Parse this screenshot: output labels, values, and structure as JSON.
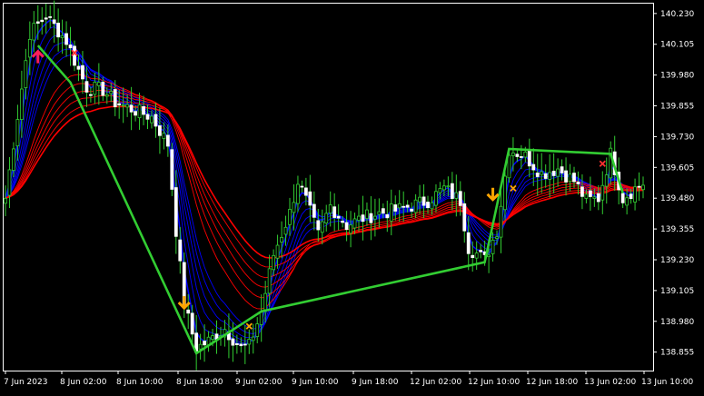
{
  "chart_data": {
    "type": "candlestick",
    "instrument_timeframe": "",
    "y_ticks": [
      "140.230",
      "140.105",
      "139.980",
      "139.855",
      "139.730",
      "139.605",
      "139.480",
      "139.355",
      "139.230",
      "139.105",
      "138.980",
      "138.855"
    ],
    "y_range": [
      138.78,
      140.27
    ],
    "x_ticks": [
      "7 Jun 2023",
      "8 Jun 02:00",
      "8 Jun 10:00",
      "8 Jun 18:00",
      "9 Jun 02:00",
      "9 Jun 10:00",
      "9 Jun 18:00",
      "12 Jun 02:00",
      "12 Jun 10:00",
      "12 Jun 18:00",
      "13 Jun 02:00",
      "13 Jun 10:00"
    ],
    "colors": {
      "background": "#000000",
      "bull_candle": "#32cd32",
      "bear_candle": "#ffffff",
      "fast_ribbon": "#0000ff",
      "slow_ribbon": "#ff0000",
      "zigzag": "#32cd32",
      "arrow_up": "#ff1f5a",
      "arrow_down": "#ffa500",
      "cross_red": "#ff3030",
      "cross_orange": "#ffa500"
    },
    "price_path": [
      [
        0,
        139.48
      ],
      [
        6,
        140.15
      ],
      [
        10,
        140.22
      ],
      [
        15,
        140.12
      ],
      [
        18,
        140.0
      ],
      [
        20,
        139.93
      ],
      [
        24,
        139.92
      ],
      [
        27,
        139.87
      ],
      [
        30,
        139.85
      ],
      [
        33,
        139.83
      ],
      [
        36,
        139.81
      ],
      [
        40,
        139.7
      ],
      [
        42,
        139.35
      ],
      [
        44,
        139.05
      ],
      [
        47,
        138.87
      ],
      [
        50,
        138.9
      ],
      [
        54,
        138.95
      ],
      [
        58,
        138.87
      ],
      [
        60,
        138.88
      ],
      [
        63,
        139.02
      ],
      [
        66,
        139.25
      ],
      [
        70,
        139.42
      ],
      [
        72,
        139.55
      ],
      [
        74,
        139.47
      ],
      [
        77,
        139.33
      ],
      [
        80,
        139.45
      ],
      [
        84,
        139.37
      ],
      [
        88,
        139.4
      ],
      [
        92,
        139.42
      ],
      [
        96,
        139.43
      ],
      [
        100,
        139.45
      ],
      [
        104,
        139.47
      ],
      [
        108,
        139.52
      ],
      [
        112,
        139.47
      ],
      [
        114,
        139.28
      ],
      [
        118,
        139.23
      ],
      [
        121,
        139.35
      ],
      [
        124,
        139.68
      ],
      [
        128,
        139.65
      ],
      [
        132,
        139.58
      ],
      [
        136,
        139.6
      ],
      [
        140,
        139.55
      ],
      [
        143,
        139.47
      ],
      [
        146,
        139.48
      ],
      [
        149,
        139.66
      ],
      [
        152,
        139.48
      ],
      [
        155,
        139.52
      ],
      [
        157,
        139.54
      ]
    ],
    "zigzag": [
      [
        8,
        140.1
      ],
      [
        16,
        139.95
      ],
      [
        47,
        138.85
      ],
      [
        63,
        139.02
      ],
      [
        118,
        139.22
      ],
      [
        124,
        139.68
      ],
      [
        149,
        139.66
      ],
      [
        152,
        139.5
      ]
    ],
    "signals": [
      {
        "kind": "arrow_up",
        "bar": 8,
        "price": 140.05
      },
      {
        "kind": "cross_red",
        "bar": 17,
        "price": 140.07
      },
      {
        "kind": "arrow_down",
        "bar": 44,
        "price": 139.06
      },
      {
        "kind": "cross_orange",
        "bar": 60,
        "price": 138.96
      },
      {
        "kind": "arrow_down",
        "bar": 120,
        "price": 139.5
      },
      {
        "kind": "cross_orange",
        "bar": 125,
        "price": 139.52
      },
      {
        "kind": "cross_red",
        "bar": 147,
        "price": 139.62
      }
    ],
    "bars": 158
  }
}
